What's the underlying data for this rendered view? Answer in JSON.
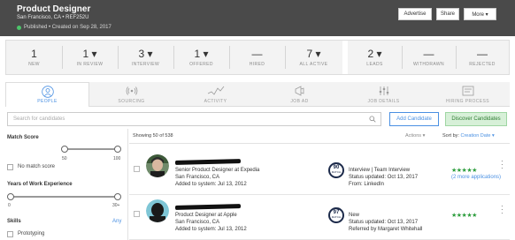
{
  "header": {
    "title": "Product Designer",
    "subtitle": "San Francisco, CA  •  REF252U",
    "status": "Published  •  Created on Sep 28, 2017",
    "buttons": {
      "advertise": "Advertise",
      "share": "Share",
      "more": "More  ▾"
    },
    "colors": {
      "background": "#4a4a4a",
      "published_dot": "#4cc46a"
    }
  },
  "stats": [
    {
      "value": "1",
      "label": "NEW"
    },
    {
      "value": "1 ▾",
      "label": "IN REVIEW"
    },
    {
      "value": "3 ▾",
      "label": "INTERVIEW"
    },
    {
      "value": "1 ▾",
      "label": "OFFERED"
    },
    {
      "value": "—",
      "label": "HIRED"
    },
    {
      "value": "7 ▾",
      "label": "ALL ACTIVE"
    },
    {
      "value": "2 ▾",
      "label": "LEADS"
    },
    {
      "value": "—",
      "label": "WITHDRAWN"
    },
    {
      "value": "—",
      "label": "REJECTED"
    }
  ],
  "tabs": [
    {
      "label": "PEOPLE",
      "icon": "person-icon",
      "active": true
    },
    {
      "label": "SOURCING",
      "icon": "broadcast-icon",
      "active": false
    },
    {
      "label": "ACTIVITY",
      "icon": "activity-icon",
      "active": false
    },
    {
      "label": "JOB AD",
      "icon": "megaphone-icon",
      "active": false
    },
    {
      "label": "JOB DETAILS",
      "icon": "sliders-icon",
      "active": false
    },
    {
      "label": "HIRING PROCESS",
      "icon": "process-icon",
      "active": false
    }
  ],
  "search": {
    "placeholder": "Search for candidates",
    "add_label": "Add Candidate",
    "discover_label": "Discover Candidates"
  },
  "filters": {
    "match_score": {
      "title": "Match Score",
      "min_label": "50",
      "max_label": "100",
      "no_match_label": "No match score"
    },
    "experience": {
      "title": "Years of Work Experience",
      "min_label": "0",
      "max_label": "30+"
    },
    "skills": {
      "title": "Skills",
      "any_label": "Any",
      "first_skill": "Prototyping"
    }
  },
  "results": {
    "showing": "Showing 50 of 538",
    "actions": "Actions  ▾",
    "sort_label": "Sort by:",
    "sort_value": "Creation Date  ▾"
  },
  "candidates": [
    {
      "title": "Senior Product Designer at Expedia",
      "location": "San Francisco, CA",
      "added": "Added to system: Jul 13, 2012",
      "match": "90",
      "match_label": "MATCH",
      "stage": "Interview | Team Interview",
      "updated": "Status updated: Oct 13, 2017",
      "source": "From: LinkedIn",
      "rating": "★★★★★",
      "extra": "(2 more applications)"
    },
    {
      "title": "Product Designer at Apple",
      "location": "San Francisco, CA",
      "added": "Added to system: Jul 13, 2012",
      "match": "97",
      "match_label": "MATCH",
      "stage": "New",
      "updated": "Status updated: Oct 13, 2017",
      "source": "Referred by Margaret Whitehall",
      "rating": "★★★★★",
      "extra": ""
    }
  ]
}
